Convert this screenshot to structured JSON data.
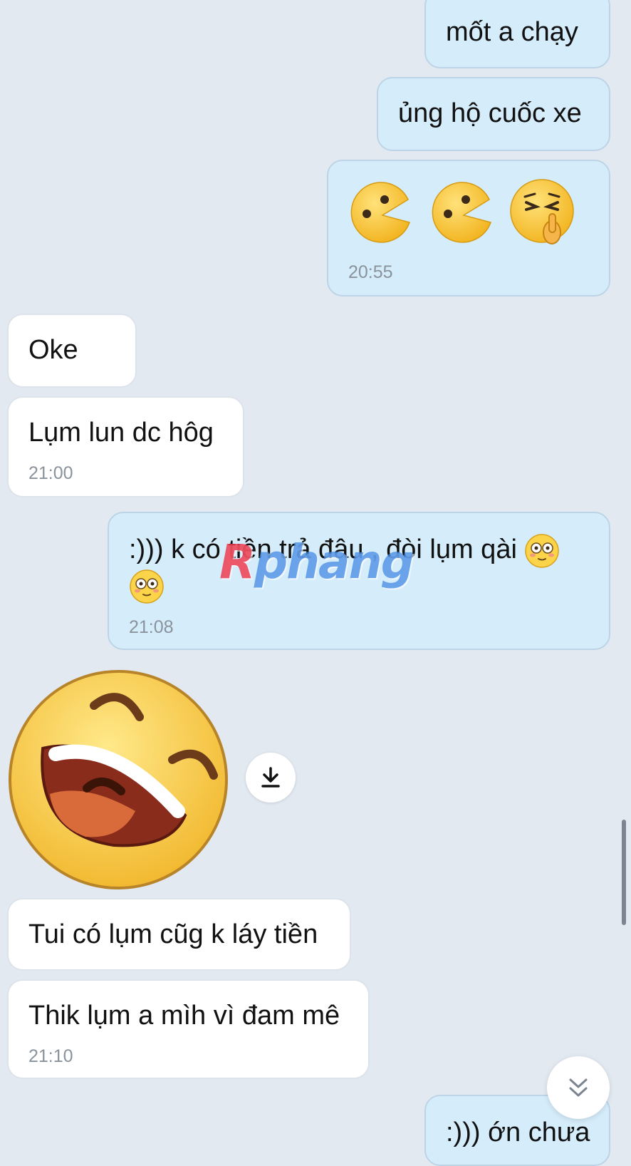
{
  "messages": [
    {
      "id": "m1",
      "dir": "out",
      "text": "mốt a chạy"
    },
    {
      "id": "m2",
      "dir": "out",
      "text": "ủng hộ cuốc xe"
    },
    {
      "id": "m3",
      "dir": "out",
      "stickers": [
        "pacman-emoji",
        "pacman-emoji",
        "shush-emoji"
      ],
      "time": "20:55"
    },
    {
      "id": "m4",
      "dir": "in",
      "text": "Oke"
    },
    {
      "id": "m5",
      "dir": "in",
      "text": "Lụm lun dc hôg",
      "time": "21:00"
    },
    {
      "id": "m6",
      "dir": "out",
      "text_line1": ":))) k có tiền trả đâu , đòi lụm qài",
      "emoji": "flushed-emoji",
      "time": "21:08"
    },
    {
      "id": "m7",
      "dir": "in",
      "sticker": "laughing-sticker"
    },
    {
      "id": "m8",
      "dir": "in",
      "text": "Tui có lụm cũg k láy tiền"
    },
    {
      "id": "m9",
      "dir": "in",
      "text": "Thik lụm a mìh vì đam mê",
      "time": "21:10"
    },
    {
      "id": "m10",
      "dir": "out",
      "text": ":))) ớn chưa"
    }
  ],
  "watermark": {
    "first": "R",
    "rest": "phang"
  },
  "icons": {
    "download": "download-icon",
    "scroll_down": "double-chevron-down-icon"
  },
  "colors": {
    "background": "#e2e9f1",
    "outgoing_bubble": "#d5ecfa",
    "incoming_bubble": "#ffffff",
    "time_text": "#8a939c"
  }
}
